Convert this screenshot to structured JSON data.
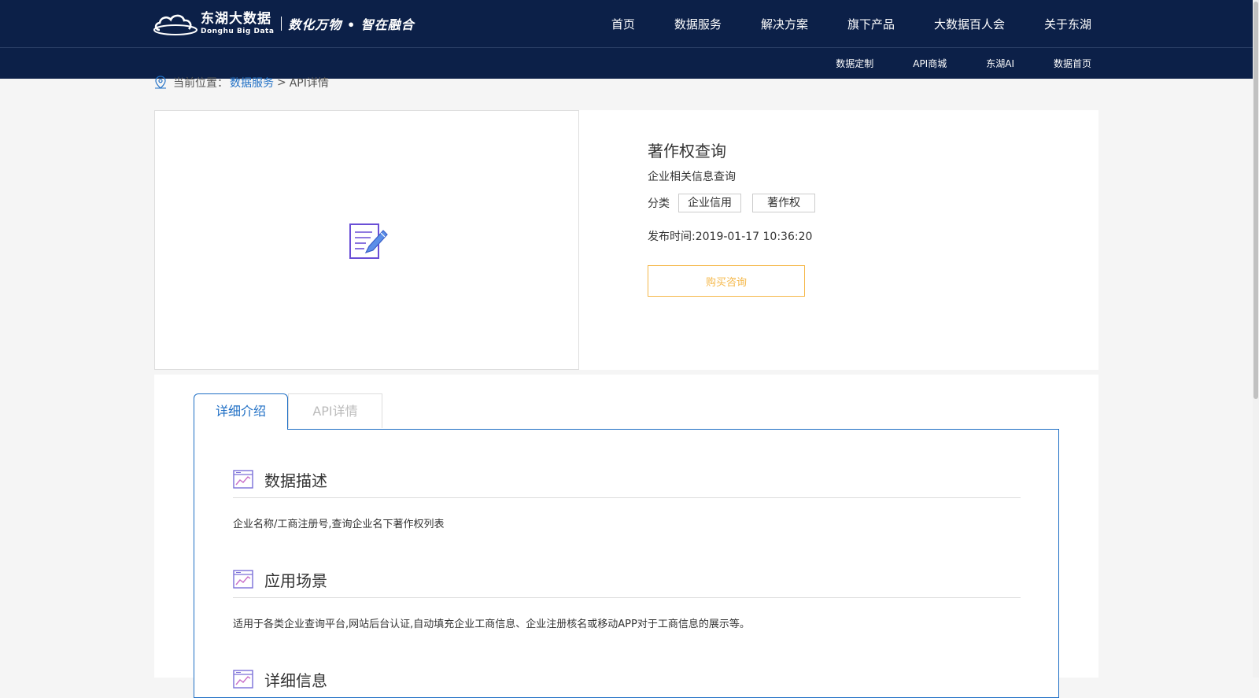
{
  "brand": {
    "logo_cn": "东湖大数据",
    "logo_en": "Donghu Big Data",
    "slogan": "数化万物 • 智在融合"
  },
  "main_nav": [
    "首页",
    "数据服务",
    "解决方案",
    "旗下产品",
    "大数据百人会",
    "关于东湖"
  ],
  "sub_nav": [
    "数据定制",
    "API商城",
    "东湖AI",
    "数据首页"
  ],
  "breadcrumb": {
    "prefix": "当前位置：",
    "link": "数据服务",
    "separator": ">",
    "current": "API详情"
  },
  "product": {
    "title": "著作权查询",
    "subtitle": "企业相关信息查询",
    "category_label": "分类",
    "tags": [
      "企业信用",
      "著作权"
    ],
    "publish_time": "发布时间:2019-01-17 10:36:20",
    "buy_button": "购买咨询"
  },
  "tabs": {
    "detail": "详细介绍",
    "api": "API详情"
  },
  "sections": [
    {
      "title": "数据描述",
      "body": "企业名称/工商注册号,查询企业名下著作权列表"
    },
    {
      "title": "应用场景",
      "body": "适用于各类企业查询平台,网站后台认证,自动填充企业工商信息、企业注册核名或移动APP对于工商信息的展示等。"
    },
    {
      "title": "详细信息",
      "body": ""
    }
  ],
  "colors": {
    "header_bg": "#0c2048",
    "link_blue": "#1f6fc5",
    "accent_orange": "#f5b84a"
  },
  "icons": [
    "cloud-logo-icon",
    "location-pin-icon",
    "document-edit-icon",
    "chart-window-icon"
  ]
}
